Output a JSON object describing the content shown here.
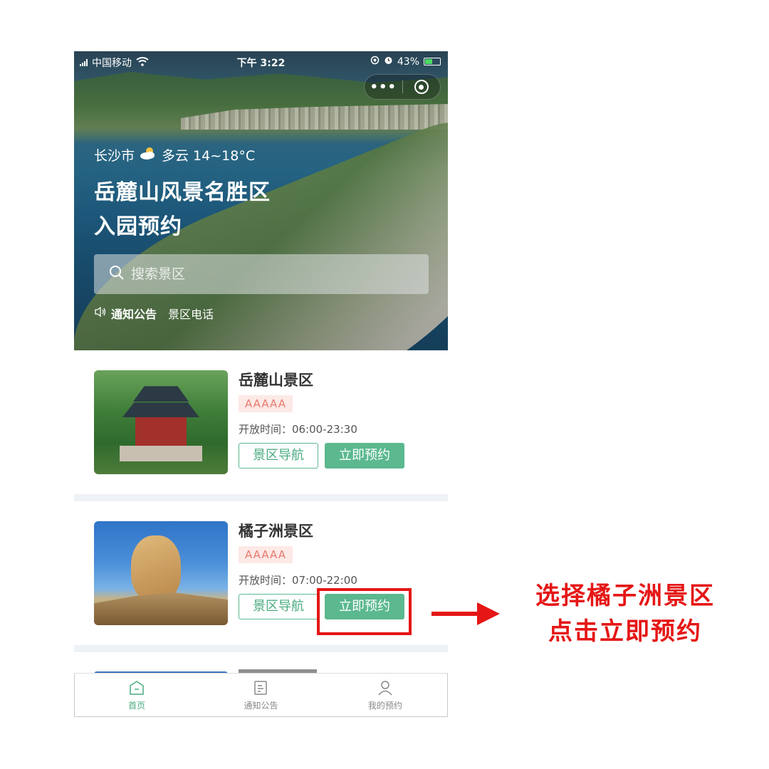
{
  "status_bar": {
    "carrier": "中国移动",
    "time": "下午 3:22",
    "battery_percent": "43%"
  },
  "header": {
    "city": "长沙市",
    "weather_text": "多云 14~18°C",
    "title_line1": "岳麓山风景名胜区",
    "title_line2": "入园预约",
    "search_placeholder": "搜索景区",
    "notice_label": "通知公告",
    "phone_label": "景区电话"
  },
  "scenic_spots": [
    {
      "name": "岳麓山景区",
      "rating": "AAAAA",
      "hours": "开放时间：06:00-23:30",
      "nav_label": "景区导航",
      "book_label": "立即预约"
    },
    {
      "name": "橘子洲景区",
      "rating": "AAAAA",
      "hours": "开放时间：07:00-22:00",
      "nav_label": "景区导航",
      "book_label": "立即预约"
    }
  ],
  "tabbar": {
    "items": [
      {
        "label": "首页",
        "icon": "home-icon",
        "active": true
      },
      {
        "label": "通知公告",
        "icon": "document-icon",
        "active": false
      },
      {
        "label": "我的预约",
        "icon": "user-icon",
        "active": false
      }
    ]
  },
  "annotation": {
    "line1": "选择橘子洲景区",
    "line2": "点击立即预约",
    "color": "#e51616"
  },
  "colors": {
    "accent_green": "#5bb88f",
    "badge_bg": "#fde9e6",
    "badge_text": "#e77a6f"
  }
}
